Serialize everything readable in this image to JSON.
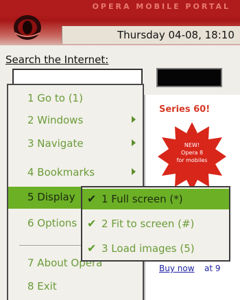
{
  "header": {
    "brand": "OPERA MOBILE PORTAL",
    "datetime": "Thursday 04-08, 18:10",
    "colors": {
      "header_red": "#b01b1b",
      "accent_green": "#6cb026"
    }
  },
  "search": {
    "label": "Search the Internet:",
    "value": "",
    "go_label": ""
  },
  "page": {
    "promo": "Series 60!",
    "starburst_text": "NEW!\nOpera 8\nfor mobiles",
    "buy_link": "Buy now",
    "buy_rest": "at 9"
  },
  "menu": {
    "items": [
      {
        "label": "1 Go to (1)",
        "has_submenu": false
      },
      {
        "label": "2 Windows",
        "has_submenu": true
      },
      {
        "label": "3 Navigate",
        "has_submenu": true
      },
      {
        "label": "4 Bookmarks",
        "has_submenu": true
      },
      {
        "label": "5 Display",
        "has_submenu": true,
        "selected": true
      },
      {
        "label": "6 Options",
        "has_submenu": true
      },
      {
        "label": "7 About Opera",
        "has_submenu": false
      },
      {
        "label": "8 Exit",
        "has_submenu": false
      }
    ]
  },
  "submenu": {
    "items": [
      {
        "check": "✔",
        "label": "1 Full screen (*)",
        "selected": true
      },
      {
        "check": "✔",
        "label": "2 Fit to screen (#)",
        "selected": false
      },
      {
        "check": "✔",
        "label": "3 Load images (5)",
        "selected": false
      }
    ]
  },
  "icons": {
    "logo": "opera-logo-icon",
    "arrow": "chevron-right-icon",
    "check": "check-icon"
  }
}
